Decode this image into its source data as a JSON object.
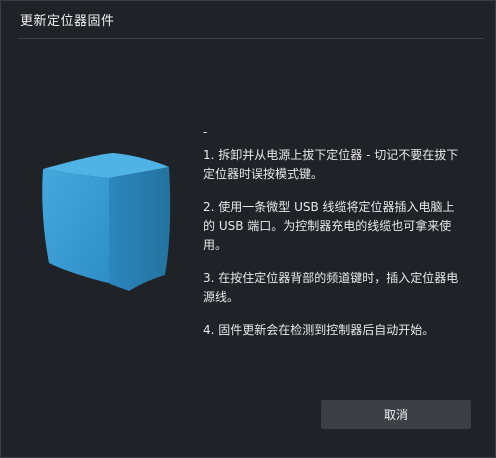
{
  "window": {
    "title": "更新定位器固件"
  },
  "illustration": {
    "icon": "positioner-device-cube-icon",
    "color": "#3a9fd6"
  },
  "instructions": {
    "lead": "-",
    "steps": [
      "1. 拆卸并从电源上拔下定位器 - 切记不要在拔下定位器时误按模式键。",
      "2. 使用一条微型 USB 线缆将定位器插入电脑上的 USB 端口。为控制器充电的线缆也可拿来使用。",
      "3. 在按住定位器背部的频道键时，插入定位器电源线。",
      "4. 固件更新会在检测到控制器后自动开始。"
    ]
  },
  "footer": {
    "cancel_label": "取消"
  },
  "colors": {
    "background": "#1f2226",
    "button": "#3c3f44",
    "accent": "#3a9fd6"
  }
}
